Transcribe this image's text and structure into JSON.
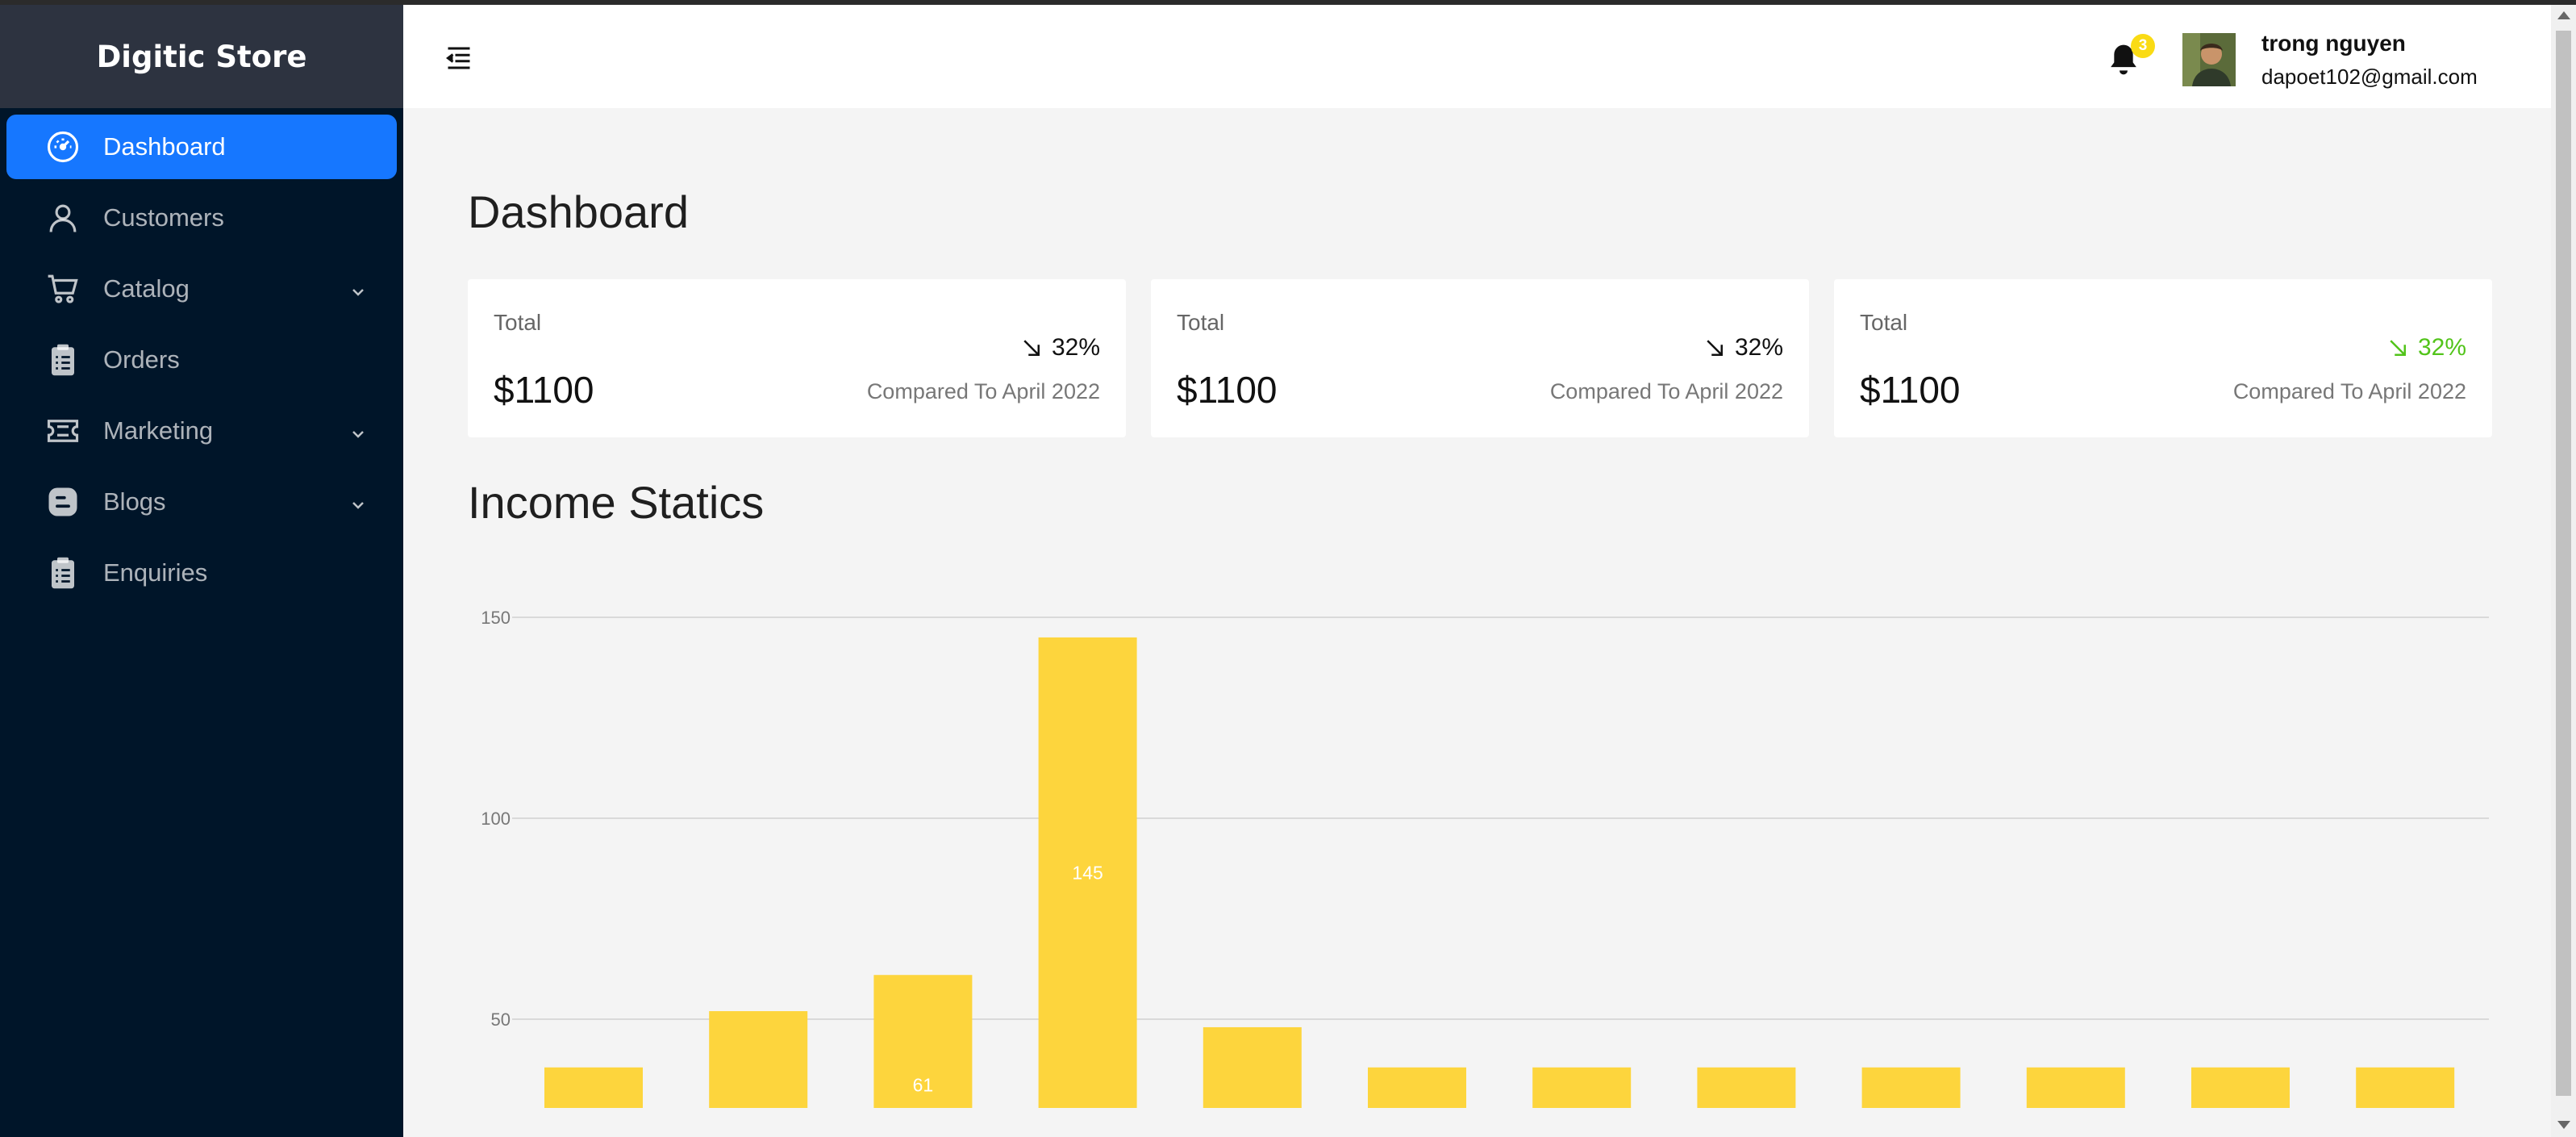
{
  "app": {
    "title": "Digitic Store"
  },
  "sidebar": {
    "items": [
      {
        "label": "Dashboard",
        "icon": "dashboard-icon",
        "active": true,
        "has_submenu": false
      },
      {
        "label": "Customers",
        "icon": "user-icon",
        "active": false,
        "has_submenu": false
      },
      {
        "label": "Catalog",
        "icon": "shopping-cart-icon",
        "active": false,
        "has_submenu": true
      },
      {
        "label": "Orders",
        "icon": "clipboard-list-icon",
        "active": false,
        "has_submenu": false
      },
      {
        "label": "Marketing",
        "icon": "ticket-icon",
        "active": false,
        "has_submenu": true
      },
      {
        "label": "Blogs",
        "icon": "blogger-icon",
        "active": false,
        "has_submenu": true
      },
      {
        "label": "Enquiries",
        "icon": "clipboard-icon",
        "active": false,
        "has_submenu": false
      }
    ]
  },
  "header": {
    "notification_count": "3",
    "user": {
      "name": "trong nguyen",
      "email": "dapoet102@gmail.com"
    }
  },
  "main": {
    "page_title": "Dashboard",
    "cards": [
      {
        "label": "Total",
        "value": "$1100",
        "change": "32%",
        "trend": "down",
        "color": "#000000",
        "compare": "Compared To April 2022"
      },
      {
        "label": "Total",
        "value": "$1100",
        "change": "32%",
        "trend": "down",
        "color": "#000000",
        "compare": "Compared To April 2022"
      },
      {
        "label": "Total",
        "value": "$1100",
        "change": "32%",
        "trend": "down",
        "color": "#52c41a",
        "compare": "Compared To April 2022"
      }
    ],
    "section_title": "Income Statics"
  },
  "colors": {
    "sidebar_bg": "#001529",
    "active": "#1677ff",
    "bar": "#fdd53d",
    "badge": "#fadb14"
  },
  "chart_data": {
    "type": "bar",
    "categories": [
      "",
      "",
      "",
      "",
      "",
      "",
      "",
      "",
      "",
      "",
      "",
      ""
    ],
    "values": [
      38,
      52,
      61,
      145,
      48,
      38,
      38,
      38,
      38,
      38,
      38,
      38
    ],
    "data_labels": {
      "2": "61",
      "3": "145"
    },
    "yticks": [
      50,
      100,
      150
    ],
    "ylim": [
      30,
      150
    ],
    "grid": true,
    "title": "",
    "xlabel": "",
    "ylabel": ""
  }
}
